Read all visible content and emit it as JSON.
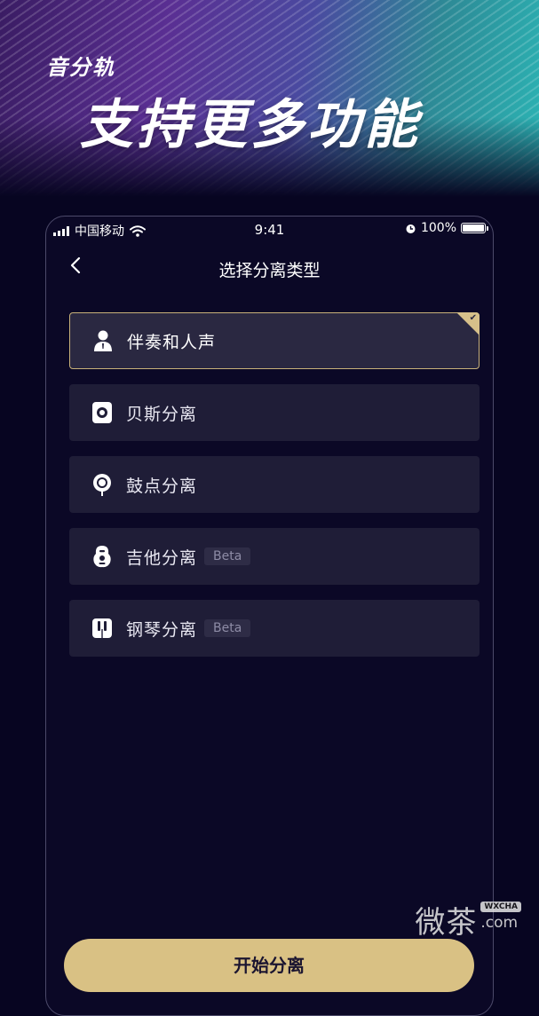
{
  "banner": {
    "subtitle": "音分轨",
    "title": "支持更多功能"
  },
  "status_bar": {
    "carrier": "中国移动",
    "time": "9:41",
    "battery": "100%",
    "battery_level": 1.0
  },
  "nav": {
    "title": "选择分离类型"
  },
  "options": [
    {
      "label": "伴奏和人声",
      "selected": true,
      "icon": "person-icon"
    },
    {
      "label": "贝斯分离",
      "selected": false,
      "icon": "speaker-icon"
    },
    {
      "label": "鼓点分离",
      "selected": false,
      "icon": "drum-icon"
    },
    {
      "label": "吉他分离",
      "selected": false,
      "icon": "guitar-icon",
      "badge": "Beta"
    },
    {
      "label": "钢琴分离",
      "selected": false,
      "icon": "piano-icon",
      "badge": "Beta"
    }
  ],
  "bottom_button": {
    "label": "开始分离"
  },
  "watermark": {
    "text": "微茶",
    "badge": "WXCHA",
    "domain": ".com"
  },
  "colors": {
    "accent": "#d9c184",
    "option_bg": "#1f1d37",
    "page_bg": "#070521"
  }
}
